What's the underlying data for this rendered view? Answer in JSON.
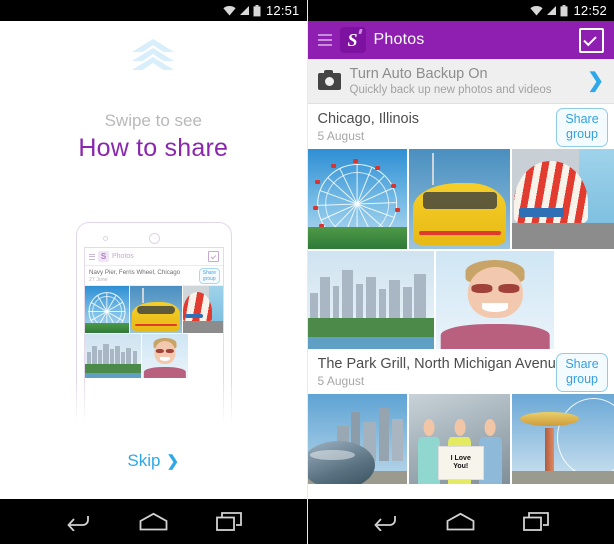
{
  "left_screen": {
    "statusbar": {
      "time": "12:51",
      "icons": [
        "wifi-icon",
        "signal-icon",
        "battery-icon"
      ]
    },
    "onboarding": {
      "chevrons_icon": "triple-chevron-up-icon",
      "subtitle": "Swipe to see",
      "title": "How to share",
      "skip_label": "Skip",
      "skip_chevron": "❯"
    },
    "mockup": {
      "app_title": "Photos",
      "menu_icon": "hamburger-menu-icon",
      "logo_icon": "app-logo-icon",
      "logo_letter": "S",
      "select_icon": "checkbox-icon",
      "album_title": "Navy Pier, Ferris Wheel, Chicago",
      "album_date": "27 June",
      "share_line1": "Share",
      "share_line2": "group"
    }
  },
  "right_screen": {
    "statusbar": {
      "time": "12:52",
      "icons": [
        "wifi-icon",
        "signal-icon",
        "battery-icon"
      ]
    },
    "appbar": {
      "menu_icon": "hamburger-menu-icon",
      "logo_icon": "app-logo-icon",
      "logo_letter": "S",
      "title": "Photos",
      "select_icon": "checkbox-select-all-icon",
      "bg_color": "#8e1fb0"
    },
    "backup_banner": {
      "icon": "camera-icon",
      "title": "Turn Auto Backup On",
      "subtitle": "Quickly back up new photos and videos",
      "chevron": "❯",
      "chevron_color": "#2ea8e8"
    },
    "albums": [
      {
        "title": "Chicago, Illinois",
        "date": "5 August",
        "share_line1": "Share",
        "share_line2": "group",
        "photos_row1": [
          "ferris-wheel-photo",
          "yellow-speedboat-photo",
          "carousel-tent-photo"
        ],
        "photos_row2": [
          "chicago-skyline-photo",
          "man-sunglasses-selfie-photo"
        ]
      },
      {
        "title": "The Park Grill, North Michigan Avenu…",
        "date": "5 August",
        "share_line1": "Share",
        "share_line2": "group",
        "photos_row1": [
          "cloud-gate-bean-photo",
          "three-women-sign-photo",
          "swing-ride-photo"
        ],
        "sign_text_line1": "I Love",
        "sign_text_line2": "You!"
      }
    ]
  },
  "navbar": {
    "back_icon": "back-arrow-icon",
    "home_icon": "home-icon",
    "recents_icon": "recent-apps-icon"
  },
  "colors": {
    "purple": "#8e1fb0",
    "title_purple": "#8a27ae",
    "blue": "#2ea8e8",
    "chevron_light": "#d8eefb"
  }
}
